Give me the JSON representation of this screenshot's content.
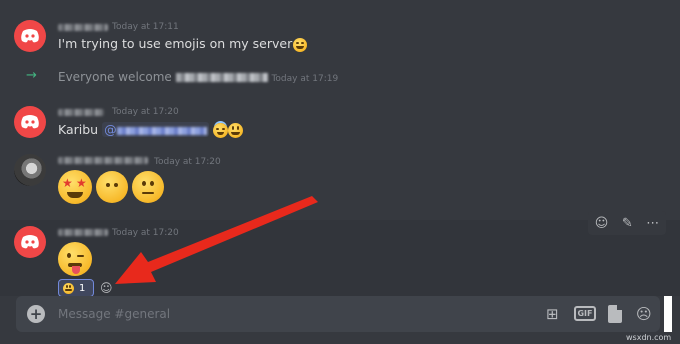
{
  "colors": {
    "background": "#36393f",
    "discord_red": "#f04747",
    "join_green": "#43b581",
    "mention_blue": "#7289da",
    "callout_arrow": "#e8291c"
  },
  "messages": [
    {
      "timestamp": "Today at 17:11",
      "text": "I'm trying to use emojis on my server",
      "emoji": "grinning-squinting"
    },
    {
      "type": "join",
      "prefix": "Everyone welcome",
      "timestamp": "Today at 17:19"
    },
    {
      "timestamp": "Today at 17:20",
      "text": "Karibu",
      "mention_prefix": "@",
      "emojis": [
        "smiling-halo",
        "grinning"
      ]
    },
    {
      "timestamp": "Today at 17:20",
      "emojis": [
        "star-struck",
        "no-mouth",
        "neutral-face"
      ]
    },
    {
      "timestamp": "Today at 17:20",
      "emoji": "winking-tongue"
    }
  ],
  "reaction": {
    "emoji": "grinning",
    "count": "1"
  },
  "toolbar": {
    "icons": [
      "add-reaction-icon",
      "edit-icon",
      "more-icon"
    ]
  },
  "composer": {
    "placeholder": "Message #general",
    "gif_label": "GIF"
  },
  "watermark": "wsxdn.com"
}
